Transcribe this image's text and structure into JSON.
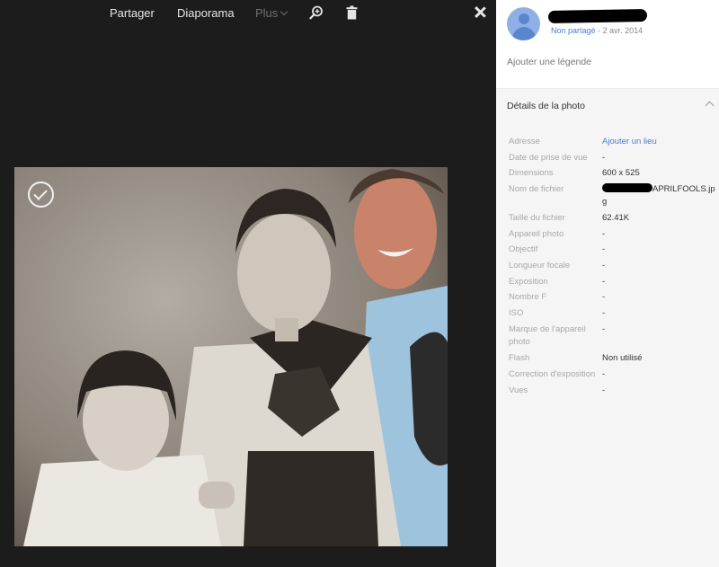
{
  "toolbar": {
    "share_label": "Partager",
    "slideshow_label": "Diaporama",
    "more_label": "Plus",
    "zoom_icon": "zoom-in-icon",
    "delete_icon": "trash-icon",
    "close_icon": "close-icon"
  },
  "photo": {
    "select_icon": "check-circle-icon"
  },
  "owner": {
    "sharing_status": "Non partagé",
    "date": "2 avr. 2014"
  },
  "caption": {
    "placeholder": "Ajouter une légende"
  },
  "details": {
    "title": "Détails de la photo",
    "rows": [
      {
        "label": "Adresse",
        "value": "Ajouter un lieu"
      },
      {
        "label": "Date de prise de vue",
        "value": "-"
      },
      {
        "label": "Dimensions",
        "value": "600 x 525"
      },
      {
        "label": "Nom de fichier",
        "value": "APRILFOOLS.jpg"
      },
      {
        "label": "Taille du fichier",
        "value": "62.41K"
      },
      {
        "label": "Appareil photo",
        "value": "-"
      },
      {
        "label": "Objectif",
        "value": "-"
      },
      {
        "label": "Longueur focale",
        "value": "-"
      },
      {
        "label": "Exposition",
        "value": "-"
      },
      {
        "label": "Nombre F",
        "value": "-"
      },
      {
        "label": "ISO",
        "value": "-"
      },
      {
        "label": "Marque de l'appareil photo",
        "value": "-"
      },
      {
        "label": "Flash",
        "value": "Non utilisé"
      },
      {
        "label": "Correction d'exposition",
        "value": "-"
      },
      {
        "label": "Vues",
        "value": "-"
      }
    ]
  },
  "colors": {
    "viewer_bg": "#1c1c1c",
    "panel_bg": "#ffffff",
    "details_bg": "#f5f5f5",
    "link": "#4a7bd6"
  }
}
